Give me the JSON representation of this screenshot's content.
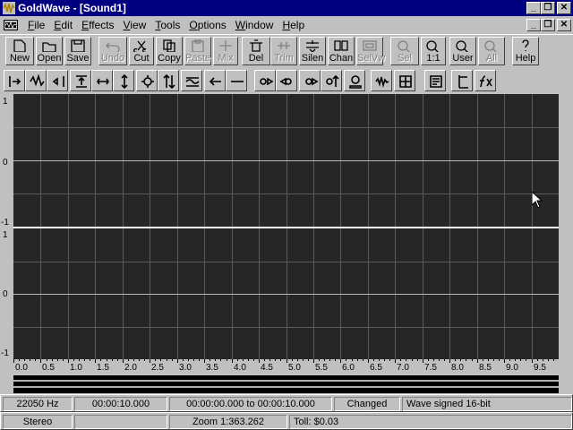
{
  "window": {
    "title": "GoldWave - [Sound1]",
    "minimize_label": "_",
    "maximize_label": "❐",
    "close_label": "✕"
  },
  "menu": {
    "items": [
      {
        "u": "F",
        "rest": "ile"
      },
      {
        "u": "E",
        "rest": "dit"
      },
      {
        "u": "E",
        "rest": "ffects"
      },
      {
        "u": "V",
        "rest": "iew"
      },
      {
        "u": "T",
        "rest": "ools"
      },
      {
        "u": "O",
        "rest": "ptions"
      },
      {
        "u": "W",
        "rest": "indow"
      },
      {
        "u": "H",
        "rest": "elp"
      }
    ]
  },
  "toolbar1": {
    "buttons": [
      "New",
      "Open",
      "Save",
      "Undo",
      "Cut",
      "Copy",
      "Paste",
      "Mix",
      "Del",
      "Trim",
      "Silen",
      "Chan",
      "SelVw",
      "Sel",
      "1:1",
      "User",
      "All",
      "Help"
    ],
    "disabled": [
      "Undo",
      "Paste",
      "Mix",
      "Trim",
      "SelVw",
      "Sel",
      "All"
    ]
  },
  "toolbar2": {
    "icons": [
      "cue-in-icon",
      "waveform-view-icon",
      "cue-out-icon",
      "expand-icon",
      "link-icon",
      "vertical-arrows-icon",
      "gear-icon",
      "swap-arrows-icon",
      "resample-icon",
      "arrow-left-icon",
      "line-icon",
      "play-icon",
      "play-back-icon",
      "play-forward-icon",
      "play-vertical-icon",
      "record-icon",
      "noise-icon",
      "filter-icon",
      "edit-icon",
      "marker-icon",
      "function-icon"
    ]
  },
  "waveform": {
    "channel_labels": [
      "1",
      "0",
      "-1"
    ],
    "time_labels": [
      "0.0",
      "0.5",
      "1.0",
      "1.5",
      "2.0",
      "2.5",
      "3.0",
      "3.5",
      "4.0",
      "4.5",
      "5.0",
      "5.5",
      "6.0",
      "6.5",
      "7.0",
      "7.5",
      "8.0",
      "8.5",
      "9.0",
      "9.5"
    ],
    "background_color": "#262626",
    "grid_color": "#5a5a5a",
    "center_color": "#b8b8b8"
  },
  "status1": {
    "rate": "22050 Hz",
    "length": "00:00:10.000",
    "range": "00:00:00.000 to 00:00:10.000",
    "state": "Changed",
    "format": "Wave signed 16-bit"
  },
  "status2": {
    "channels": "Stereo",
    "blank": "",
    "zoom": "Zoom 1:363.262",
    "toll": "Toll: $0.03"
  }
}
